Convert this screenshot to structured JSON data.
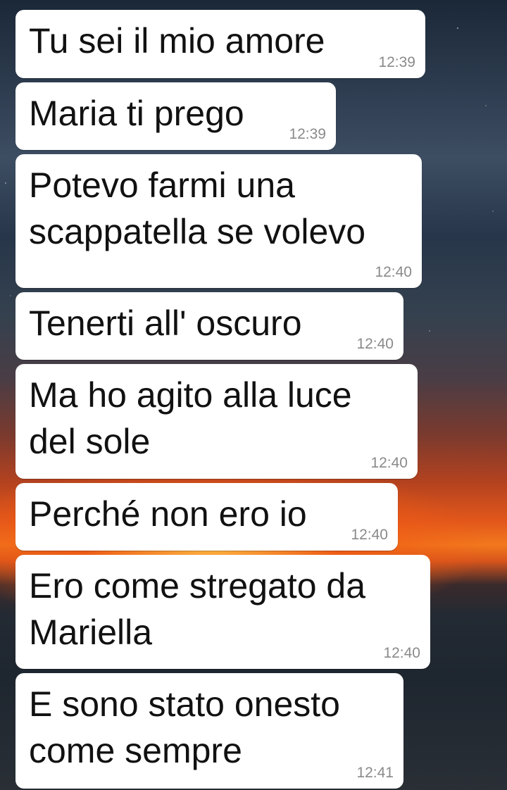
{
  "messages": [
    {
      "text": "Tu sei il mio amore",
      "time": "12:39"
    },
    {
      "text": "Maria ti prego",
      "time": "12:39"
    },
    {
      "text": "Potevo farmi una\nscappatella se volevo",
      "time": "12:40"
    },
    {
      "text": "Tenerti all' oscuro",
      "time": "12:40"
    },
    {
      "text": "Ma ho agito alla luce\ndel sole",
      "time": "12:40"
    },
    {
      "text": "Perché non ero io",
      "time": "12:40"
    },
    {
      "text": "Ero come stregato da\nMariella",
      "time": "12:40"
    },
    {
      "text": "E sono stato onesto\ncome sempre",
      "time": "12:41"
    }
  ]
}
